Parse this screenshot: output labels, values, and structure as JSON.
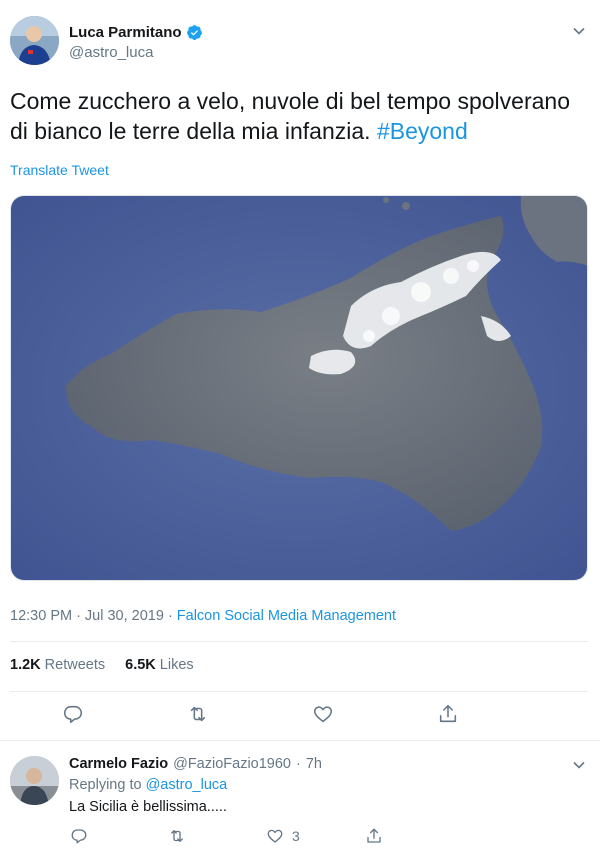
{
  "tweet": {
    "author_name": "Luca Parmitano",
    "author_handle": "@astro_luca",
    "text_main": "Come zucchero a velo, nuvole di bel tempo spolverano di bianco le terre della mia infanzia.",
    "hashtag": "#Beyond",
    "translate_label": "Translate Tweet",
    "time": "12:30 PM",
    "date": "Jul 30, 2019",
    "separator": "·",
    "source": "Falcon Social Media Management",
    "retweets_count": "1.2K",
    "retweets_label": "Retweets",
    "likes_count": "6.5K",
    "likes_label": "Likes",
    "media_alt": "Satellite image of Sicily with clouds"
  },
  "reply": {
    "author_name": "Carmelo Fazio",
    "author_handle": "@FazioFazio1960",
    "separator": "·",
    "time": "7h",
    "replying_prefix": "Replying to",
    "replying_to": "@astro_luca",
    "text": "La Sicilia è  bellissima.....",
    "likes_count": "3"
  },
  "colors": {
    "link": "#1b95e0",
    "muted": "#657786",
    "text": "#14171a",
    "divider": "#e6ecf0"
  },
  "icons": [
    "verified-badge-icon",
    "chevron-down-icon",
    "reply-icon",
    "retweet-icon",
    "like-icon",
    "share-icon"
  ]
}
